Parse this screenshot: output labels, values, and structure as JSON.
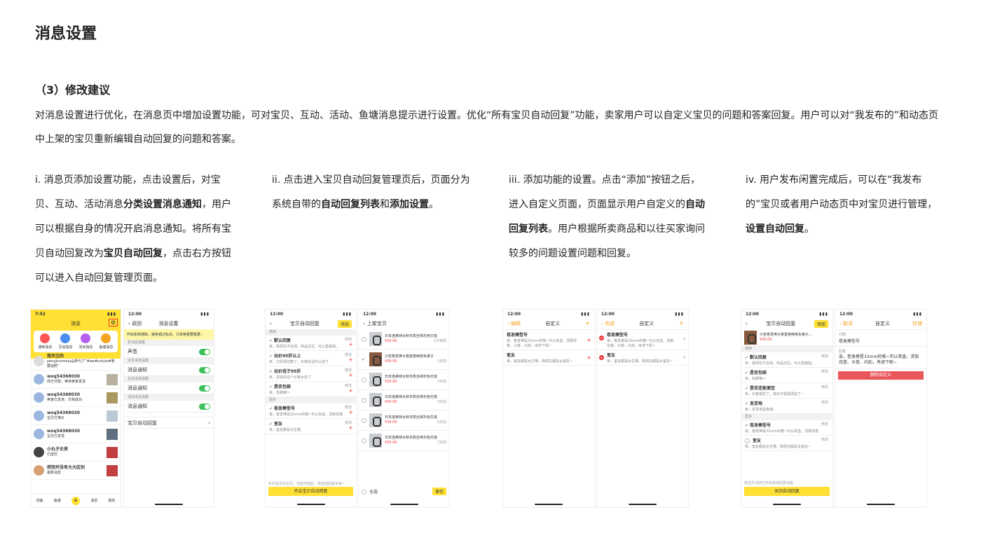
{
  "page_title": "消息设置",
  "section_title": "（3）修改建议",
  "intro": "对消息设置进行优化，在消息页中增加设置功能，可对宝贝、互动、活动、鱼塘消息提示进行设置。优化“所有宝贝自动回复”功能，卖家用户可以自定义宝贝的问题和答案回复。用户可以对“我发布的”和动态页中上架的宝贝重新编辑自动回复的问题和答案。",
  "steps": [
    {
      "p1": "i. 消息页添加设置功能，点击设置后，对宝贝、互动、活动消息",
      "b1": "分类设置消息通知",
      "p2": "，用户可以根据自身的情况开启消息通知。将所有宝贝自动回复改为",
      "b2": "宝贝自动回复",
      "p3": "，点击右方按钮可以进入自动回复管理页面。"
    },
    {
      "p1": "ii. 点击进入宝贝自动回复管理页后，页面分为系统自带的",
      "b1": "自动回复列表",
      "p2": "和",
      "b2": "添加设置",
      "p3": "。"
    },
    {
      "p1": "iii. 添加功能的设置。点击“添加”按钮之后，进入自定义页面，页面显示用户自定义的",
      "b1": "自动回复列表",
      "p2": "。用户根据所卖商品和以往买家询问较多的问题设置问题和回复。",
      "b2": "",
      "p3": ""
    },
    {
      "p1": "iv. 用户发布闲置完成后，可以在“我发布的”宝贝或者用户动态页中对宝贝进行管理，",
      "b1": "设置自动回复",
      "p2": "。",
      "b2": "",
      "p3": ""
    }
  ],
  "mock1": {
    "time": "7:52",
    "time2": "12:00",
    "msg_title": "消息",
    "cats": [
      "通知消息",
      "互动消息",
      "活动消息",
      "鱼塘消息"
    ],
    "follow_title": "我关注的",
    "follow_text": "pengkunmeiu@参与了“#we#ustyle#我要拍照”",
    "msgs": [
      {
        "name": "wxq54368030",
        "text": "你已付款，等待卖家发货"
      },
      {
        "name": "wxq54368030",
        "text": "卖家已发货，交易成功"
      },
      {
        "name": "wxq54368030",
        "text": "宝贝已降价"
      },
      {
        "name": "wxq54368030",
        "text": "宝贝已发货"
      },
      {
        "name": "小丸子女侠",
        "text": "已成交"
      },
      {
        "name": "然而并没有大大区别",
        "text": "最新消息"
      }
    ],
    "tabs": [
      "闲鱼",
      "鱼塘",
      "发布",
      "消息",
      "我的"
    ],
    "set_back": "返回",
    "set_title": "消息设置",
    "set_notice": "开启系统通知，避免错过私信、订单等重要数据",
    "g1": "新消息提醒",
    "r1": "声音",
    "g2": "宝贝消息提醒",
    "r2": "消息通知",
    "g3": "互动消息提醒",
    "r3": "消息通知",
    "g4": "活动消息提醒",
    "r4": "消息通知",
    "r5": "宝贝自动回复"
  },
  "mock2": {
    "time": "12:00",
    "title": "宝贝自动回复",
    "add": "添加",
    "g1": "通用",
    "g2": "更多",
    "items": [
      {
        "q": "默认回复",
        "a": "亲，我现在不在线，商品还在，可以直接拍。"
      },
      {
        "q": "出价95折以上",
        "a": "亲，已经很划算了，实爽的话可以拍下"
      },
      {
        "q": "出价低于95折",
        "a": "亲，您说的这个价格太低了"
      },
      {
        "q": "是否包邮",
        "a": "亲，包邮哦～"
      }
    ],
    "items2": [
      {
        "q": "卷发棒型号",
        "a": "亲，卷发棒是32mm的哦~可以夹直、烫梨花卷"
      },
      {
        "q": "室友",
        "a": "亲，室友都是女生哦"
      }
    ],
    "edit": "修改",
    "hint": "针对宝贝的宝贝，当您开启后，将自动回复买家~",
    "start_btn": "开启宝贝自动回复",
    "list_title": "上架宝贝",
    "products": [
      {
        "name": "日本连裤袜女秋冬款丝袜灰色打底",
        "price": "¥30.00",
        "time": "2分钟前"
      },
      {
        "name": "沙宣卷发棒大卷直卷两用负离子",
        "price": "¥30.00",
        "time": "1天前"
      },
      {
        "name": "日本连裤袜女秋冬款丝袜灰色打底",
        "price": "¥30.00",
        "time": "3天前"
      },
      {
        "name": "日本连裤袜女秋冬款丝袜灰色打底",
        "price": "¥30.00",
        "time": "3天前"
      },
      {
        "name": "日本连裤袜女秋冬款丝袜灰色打底",
        "price": "¥30.00",
        "time": "5天前"
      },
      {
        "name": "日本连裤袜女秋冬款丝袜灰色打底",
        "price": "¥30.00",
        "time": "7天前"
      }
    ],
    "select_all": "全选",
    "save": "保存"
  },
  "mock3": {
    "time": "12:00",
    "edit": "编辑",
    "done": "完成",
    "title": "自定义",
    "items": [
      {
        "q": "卷发棒型号",
        "a": "亲，卷发棒是32mm的哦~可以夹直、烫梨花卷、大卷、内扣，考虑下呢~"
      },
      {
        "q": "室友",
        "a": "亲，室友都是女生哦，我现在都是女室友~"
      }
    ]
  },
  "mock4": {
    "time": "12:00",
    "title": "宝贝自动回复",
    "add": "添加",
    "product": "沙宣卷发棒大卷直卷两用负离子...",
    "price": "¥30.00",
    "g1": "通用",
    "g2": "更多",
    "items": [
      {
        "q": "默认回复",
        "a": "亲，我现在不在线，商品还在，可以直接拍。"
      },
      {
        "q": "是否包邮",
        "a": "亲，包邮哦～"
      },
      {
        "q": "是否还能便宜",
        "a": "亲，价格很优了，真的不能再便宜了~"
      },
      {
        "q": "发货地",
        "a": "亲，发货地是南通。"
      }
    ],
    "items2": [
      {
        "q": "卷发棒型号",
        "a": "亲，卷发棒是32mm的哦~可以夹直、烫梨花卷"
      },
      {
        "q": "室友",
        "a": "亲，室友都是女生哦，我现在都是女室友~"
      }
    ],
    "edit": "修改",
    "hint": "该宝贝当前已开启自动回复功能",
    "close_btn": "关闭自动回复",
    "cancel": "取消",
    "c_title": "自定义",
    "c_save": "存储",
    "label_q": "问题",
    "val_q": "卷发棒型号",
    "label_a": "回复",
    "val_a": "亲，卷发棒是32mm的哦~可以夹直、烫梨花卷、大卷、内扣，考虑下呢~",
    "delete": "删除自定义"
  }
}
